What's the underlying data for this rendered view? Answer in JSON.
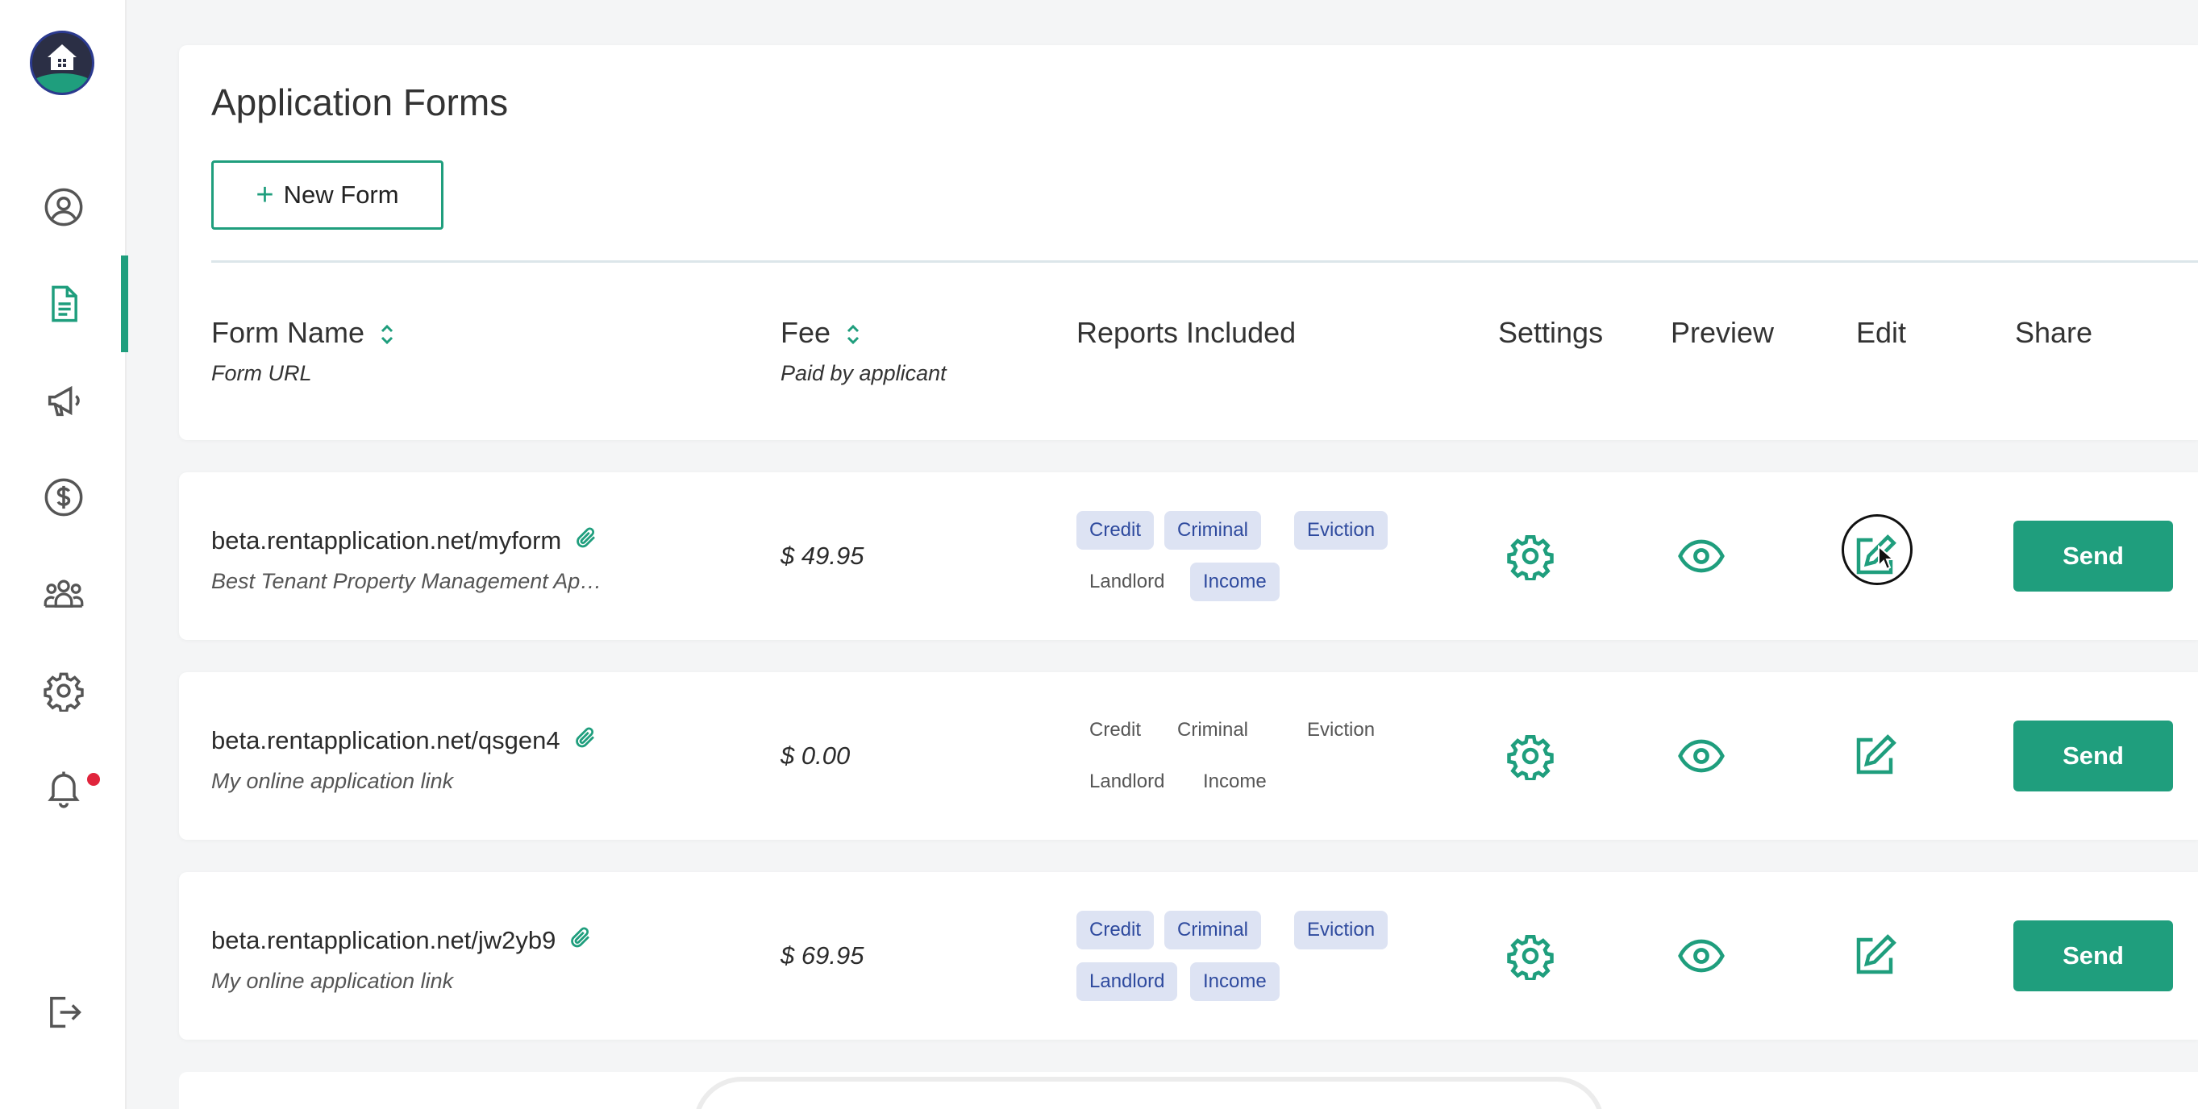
{
  "page": {
    "title": "Application Forms"
  },
  "toolbar": {
    "new_form_label": "New Form"
  },
  "sidebar": {
    "items": [
      {
        "name": "profile",
        "icon": "user-circle-icon"
      },
      {
        "name": "forms",
        "icon": "document-icon",
        "active": true
      },
      {
        "name": "marketing",
        "icon": "megaphone-icon"
      },
      {
        "name": "payments",
        "icon": "dollar-circle-icon"
      },
      {
        "name": "team",
        "icon": "users-icon"
      },
      {
        "name": "settings",
        "icon": "gear-icon"
      },
      {
        "name": "notifications",
        "icon": "bell-icon",
        "badge": true
      },
      {
        "name": "logout",
        "icon": "logout-icon"
      }
    ]
  },
  "table": {
    "headers": {
      "form_name": "Form Name",
      "form_url": "Form URL",
      "fee": "Fee",
      "fee_sub": "Paid by applicant",
      "reports": "Reports Included",
      "settings": "Settings",
      "preview": "Preview",
      "edit": "Edit",
      "share": "Share"
    },
    "send_label": "Send",
    "rows": [
      {
        "url": "beta.rentapplication.net/myform",
        "name": "Best Tenant Property Management Ap…",
        "fee": "$ 49.95",
        "tags": [
          {
            "label": "Credit",
            "on": true
          },
          {
            "label": "Criminal",
            "on": true
          },
          {
            "label": "Eviction",
            "on": true
          },
          {
            "label": "Landlord",
            "on": false
          },
          {
            "label": "Income",
            "on": true
          }
        ]
      },
      {
        "url": "beta.rentapplication.net/qsgen4",
        "name": "My online application link",
        "fee": "$ 0.00",
        "tags": [
          {
            "label": "Credit",
            "on": false
          },
          {
            "label": "Criminal",
            "on": false
          },
          {
            "label": "Eviction",
            "on": false
          },
          {
            "label": "Landlord",
            "on": false
          },
          {
            "label": "Income",
            "on": false
          }
        ]
      },
      {
        "url": "beta.rentapplication.net/jw2yb9",
        "name": "My online application link",
        "fee": "$ 69.95",
        "tags": [
          {
            "label": "Credit",
            "on": true
          },
          {
            "label": "Criminal",
            "on": true
          },
          {
            "label": "Eviction",
            "on": true
          },
          {
            "label": "Landlord",
            "on": true
          },
          {
            "label": "Income",
            "on": true
          }
        ]
      }
    ]
  },
  "colors": {
    "accent": "#1f9e7d",
    "tag_on_bg": "#dde3f3",
    "tag_on_text": "#2e4a9e",
    "badge": "#e0243c"
  }
}
